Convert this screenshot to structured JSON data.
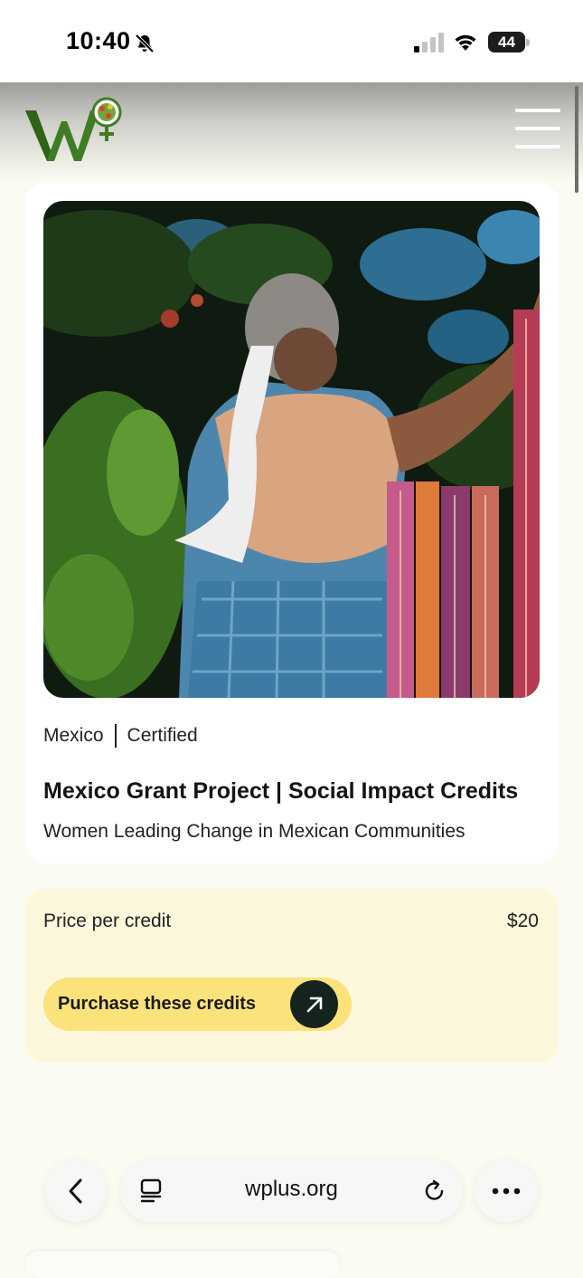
{
  "status_bar": {
    "time": "10:40",
    "battery": "44",
    "icons": [
      "bell-slash-icon",
      "cellular-signal-icon",
      "wifi-icon",
      "battery-icon"
    ]
  },
  "header": {
    "logo_icon": "wplus-logo",
    "menu_icon": "hamburger-menu-icon"
  },
  "project": {
    "image": "woman-with-woven-textiles-photo",
    "country": "Mexico",
    "status": "Certified",
    "title": "Mexico Grant Project | Social Impact Credits",
    "subtitle": "Women Leading Change in Mexican Communities"
  },
  "pricing": {
    "label": "Price per credit",
    "value": "$20",
    "purchase_label": "Purchase these credits",
    "purchase_icon": "arrow-up-right-icon"
  },
  "browser": {
    "url": "wplus.org",
    "icons": [
      "chevron-left-icon",
      "tabs-icon",
      "reload-icon",
      "more-icon"
    ]
  },
  "colors": {
    "page_background": "#fcfbf2",
    "price_card": "#fdf7dc",
    "button_yellow": "#fbe27a",
    "button_arrow_bg": "#14231e",
    "logo_green": "#3f7d25"
  }
}
